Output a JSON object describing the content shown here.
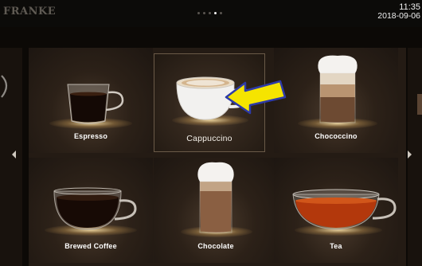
{
  "header": {
    "logo_text": "FRANKE",
    "time": "11:35",
    "date": "2018-09-06",
    "pages_total": 5,
    "page_current": 4
  },
  "tiles": [
    {
      "label": "Espresso"
    },
    {
      "label": "Cappuccino"
    },
    {
      "label": "Chococcino"
    },
    {
      "label": "Brewed Coffee"
    },
    {
      "label": "Chocolate"
    },
    {
      "label": "Tea"
    }
  ],
  "navigation": {
    "prev_icon": "arrow-left-icon",
    "next_icon": "arrow-right-icon"
  },
  "colors": {
    "background": "#0c0906",
    "annotation_arrow": "#f5e400",
    "annotation_outline": "#2d3aa8"
  }
}
